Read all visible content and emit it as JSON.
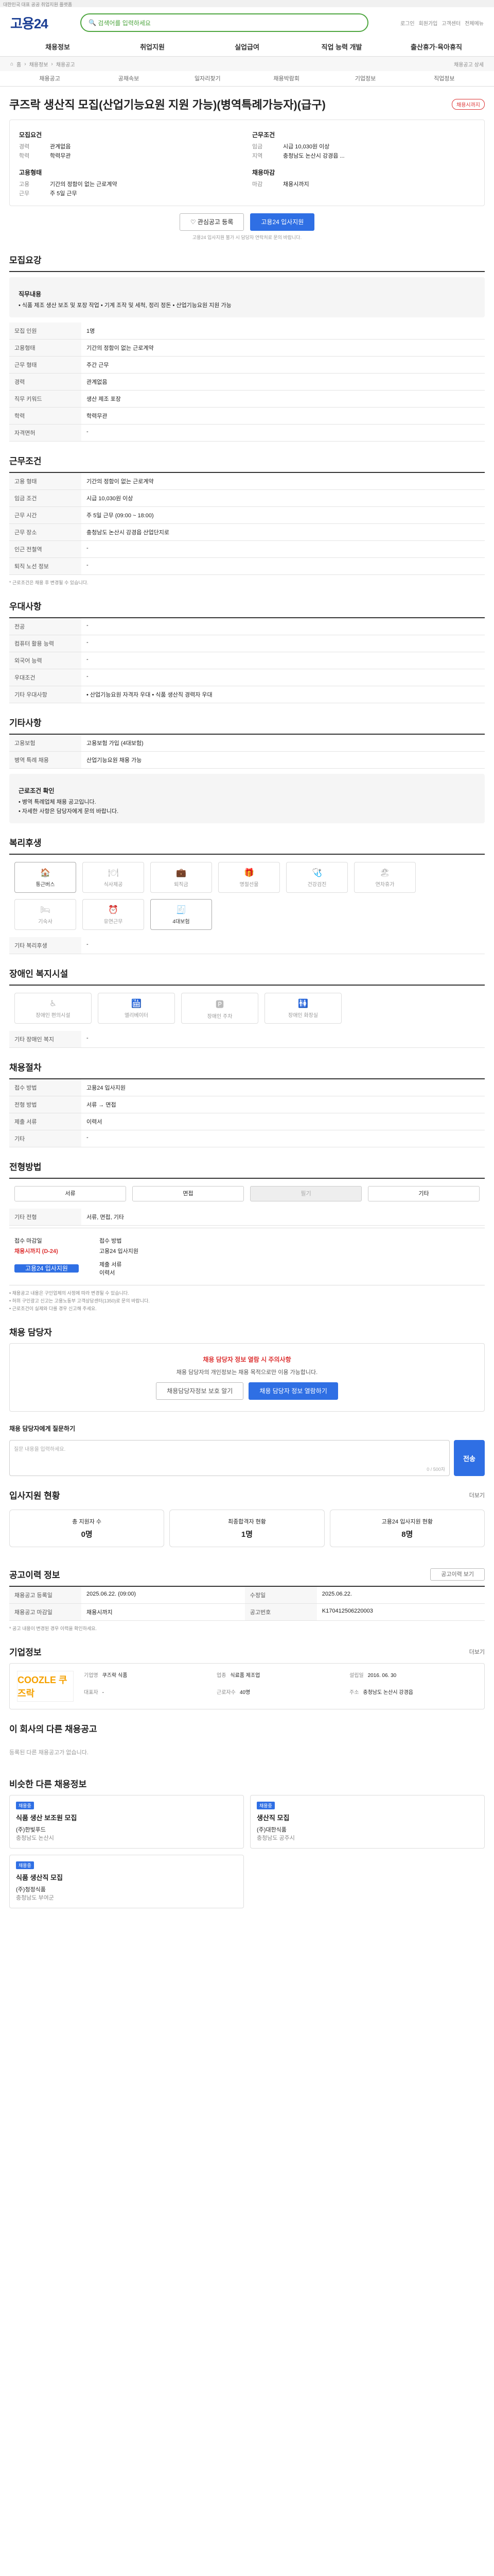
{
  "top": "대한민국 대표 공공 취업지원 플랫폼",
  "logo": "고용24",
  "search_text": "검색어를 입력하세요",
  "util": [
    "로그인",
    "회원가입",
    "고객센터",
    "전체메뉴"
  ],
  "gnb": [
    "채용정보",
    "취업지원",
    "실업급여",
    "직업 능력 개발",
    "출산휴가·육아휴직"
  ],
  "path": [
    "홈",
    "채용정보",
    "채용공고"
  ],
  "path_right": "채용공고 상세",
  "sub": [
    "채용공고",
    "공채속보",
    "일자리찾기",
    "채용박람회",
    "기업정보",
    "직업정보"
  ],
  "job": {
    "title": "쿠즈락 생산직 모집(산업기능요원 지원 가능)(병역특례가능자)(급구)",
    "badge": "채용시까지",
    "left_head": "모집요건",
    "left": [
      [
        "경력",
        "관계없음"
      ],
      [
        "학력",
        "학력무관"
      ]
    ],
    "right_head": "근무조건",
    "right": [
      [
        "임금",
        "시급 10,030원 이상"
      ],
      [
        "지역",
        "충청남도 논산시 강경읍 ..."
      ]
    ],
    "l2_head": "고용형태",
    "l2": [
      [
        "고용",
        "기간의 정함이 없는 근로계약"
      ],
      [
        "근무",
        "주 5일 근무"
      ]
    ],
    "r2_head": "채용마감",
    "r2": [
      [
        "마감",
        "채용시까지"
      ]
    ],
    "btn_fav": "관심공고 등록",
    "btn_apply": "고용24 입사지원",
    "note": "고용24 입사지원 불가 시 담당자 연락처로 문의 바랍니다."
  },
  "s1": {
    "title": "모집요강",
    "duty_h": "직무내용",
    "duty": "• 식품 제조 생산 보조 및 포장 작업 • 기계 조작 및 세척, 정리 정돈 • 산업기능요원 지원 가능",
    "rows": [
      [
        "모집 인원",
        "1명"
      ],
      [
        "고용형태",
        "기간의 정함이 없는 근로계약"
      ],
      [
        "근무 형태",
        "주간 근무"
      ],
      [
        "경력",
        "관계없음"
      ],
      [
        "직무 키워드",
        "생산 제조 포장"
      ],
      [
        "학력",
        "학력무관"
      ],
      [
        "자격면허",
        "-"
      ]
    ]
  },
  "s2": {
    "title": "근무조건",
    "rows": [
      [
        "고용 형태",
        "기간의 정함이 없는 근로계약"
      ],
      [
        "임금 조건",
        "시급 10,030원 이상"
      ],
      [
        "근무 시간",
        "주 5일 근무 (09:00 ~ 18:00)"
      ],
      [
        "근무 장소",
        "충청남도 논산시 강경읍 산업단지로"
      ],
      [
        "인근 전철역",
        "-"
      ],
      [
        "퇴직 노선 정보",
        "-"
      ]
    ],
    "note": "* 근로조건은 채용 후 변경될 수 있습니다."
  },
  "s3": {
    "title": "우대사항",
    "rows": [
      [
        "전공",
        "-"
      ],
      [
        "컴퓨터 활용 능력",
        "-"
      ],
      [
        "외국어 능력",
        "-"
      ],
      [
        "우대조건",
        "-"
      ],
      [
        "기타 우대사항",
        "• 산업기능요원 자격자 우대 • 식품 생산직 경력자 우대"
      ]
    ]
  },
  "s4": {
    "title": "기타사항",
    "rows": [
      [
        "고용보험",
        "고용보험 가입 (4대보험)"
      ],
      [
        "병역 특례 채용",
        "산업기능요원 채용 가능"
      ]
    ]
  },
  "s4b": {
    "h": "근로조건 확인",
    "lines": [
      "• 병역 특례업체 채용 공고입니다.",
      "• 자세한 사항은 담당자에게 문의 바랍니다."
    ]
  },
  "s5": {
    "title": "복리후생",
    "items": [
      [
        "🏠",
        "통근버스",
        true
      ],
      [
        "🍽",
        "식사제공",
        false
      ],
      [
        "💼",
        "퇴직금",
        false
      ],
      [
        "🎁",
        "명절선물",
        false
      ],
      [
        "🩺",
        "건강검진",
        false
      ],
      [
        "🏖",
        "연차휴가",
        false
      ],
      [
        "🛏",
        "기숙사",
        false
      ],
      [
        "⏰",
        "유연근무",
        false
      ],
      [
        "🧾",
        "4대보험",
        true
      ]
    ],
    "etc_h": "기타 복리후생",
    "etc": "-"
  },
  "s6": {
    "title": "장애인 복지시설",
    "items": [
      [
        "♿",
        "장애인 편의시설"
      ],
      [
        "🛗",
        "엘리베이터"
      ],
      [
        "🅿",
        "장애인 주차"
      ],
      [
        "🚻",
        "장애인 화장실"
      ]
    ],
    "etc_h": "기타 장애인 복지",
    "etc": "-"
  },
  "s7": {
    "title": "채용절차",
    "rows": [
      [
        "접수 방법",
        "고용24 입사지원"
      ],
      [
        "전형 방법",
        "서류 → 면접"
      ],
      [
        "제출 서류",
        "이력서"
      ],
      [
        "기타",
        "-"
      ]
    ]
  },
  "s8": {
    "title": "전형방법",
    "methods": [
      [
        "서류",
        false
      ],
      [
        "면접",
        false
      ],
      [
        "필기",
        true
      ],
      [
        "기타",
        false
      ]
    ],
    "etc_h": "기타 전형",
    "etc": "서류, 면접, 기타"
  },
  "s9": {
    "l1": "접수 마감일",
    "v1": "채용시까지 (D-24)",
    "l2": "접수 방법",
    "v2": "고용24 입사지원",
    "btn": "고용24 입사지원",
    "l3": "제출 서류",
    "v3": "이력서"
  },
  "notes": [
    "• 채용공고 내용은 구인업체의 사정에 따라 변경될 수 있습니다.",
    "• 허위 구인광고 신고는 고용노동부 고객상담센터(1350)로 문의 바랍니다.",
    "• 근로조건이 실제와 다를 경우 신고해 주세요."
  ],
  "qa": {
    "title": "채용 담당자",
    "warn": "채용 담당자 정보 열람 시 주의사항",
    "msg": "채용 담당자의 개인정보는 채용 목적으로만 이용 가능합니다.",
    "b1": "채용담당자정보 보호 알기",
    "b2": "채용 담당자 정보 열람하기",
    "qh": "채용 담당자에게 질문하기",
    "qph": "질문 내용을 입력하세요.",
    "cnt": "0 / 500자",
    "send": "전송"
  },
  "stats": {
    "title": "입사지원 현황",
    "more": "더보기",
    "cards": [
      [
        "총 지원자 수",
        "0명"
      ],
      [
        "최종합격자 현황",
        "1명"
      ],
      [
        "고용24 입사지원 현황",
        "8명"
      ]
    ]
  },
  "hist": {
    "title": "공고이력 정보",
    "btn": "공고이력 보기",
    "rows": [
      [
        "채용공고 등록일",
        "2025.06.22. (09:00)",
        "수정일",
        "2025.06.22."
      ],
      [
        "채용공고 마감일",
        "채용시까지",
        "공고번호",
        "K170412506220003"
      ]
    ],
    "note": "* 공고 내용이 변경된 경우 이력을 확인하세요."
  },
  "company": {
    "title": "기업정보",
    "more": "더보기",
    "logo": "COOZLE 쿠즈락",
    "rows": [
      [
        "기업명",
        "쿠즈락 식품"
      ],
      [
        "업종",
        "식료품 제조업"
      ],
      [
        "설립일",
        "2016. 06. 30"
      ],
      [
        "대표자",
        "-"
      ],
      [
        "근로자수",
        "40명"
      ],
      [
        "주소",
        "충청남도 논산시 강경읍"
      ]
    ]
  },
  "other": {
    "title": "이 회사의 다른 채용공고",
    "empty": "등록된 다른 채용공고가 없습니다."
  },
  "similar": {
    "title": "비슷한 다른 채용정보",
    "jobs": [
      [
        "채용중",
        "식품 생산 보조원 모집",
        "(주)한빛푸드",
        "충청남도 논산시"
      ],
      [
        "채용중",
        "생산직 모집",
        "(주)대한식품",
        "충청남도 공주시"
      ],
      [
        "채용중",
        "식품 생산직 모집",
        "(주)청정식품",
        "충청남도 부여군"
      ]
    ]
  }
}
